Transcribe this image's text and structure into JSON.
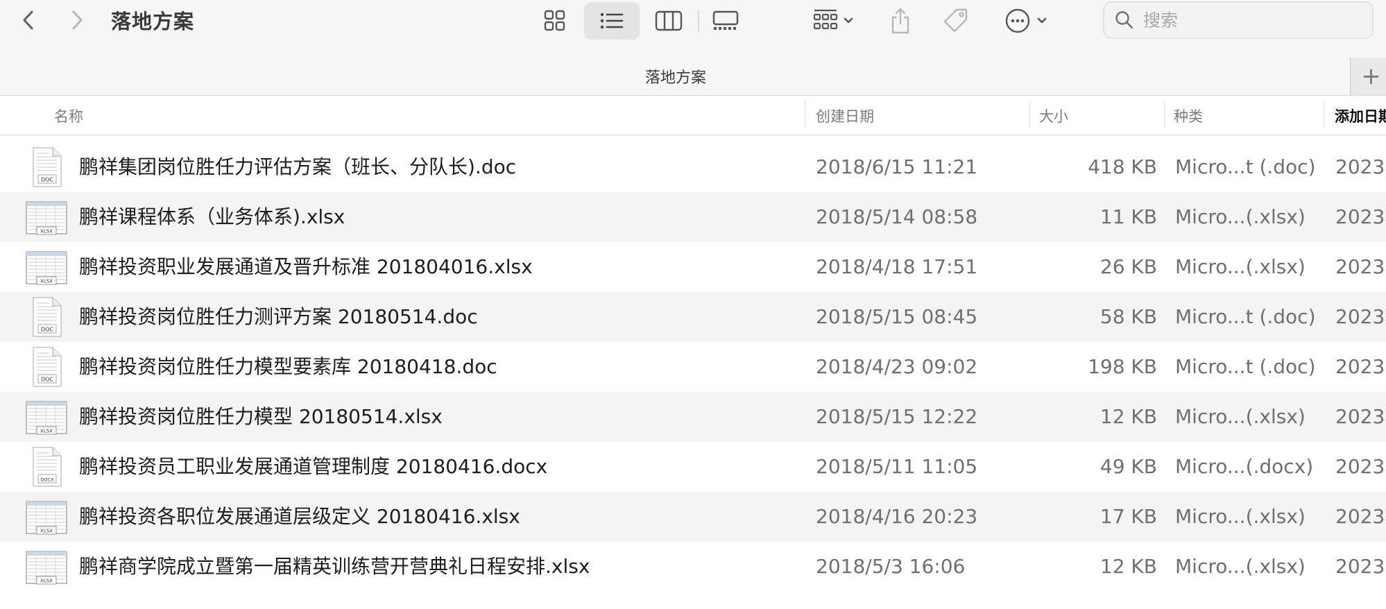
{
  "window": {
    "title": "落地方案",
    "tab_title": "落地方案",
    "tab_add": "+"
  },
  "toolbar": {
    "back_icon": "chevron-left-icon",
    "forward_icon": "chevron-right-icon",
    "view_modes": [
      "icon-view",
      "list-view",
      "column-view",
      "gallery-view"
    ],
    "active_view": "list-view",
    "group_icon": "group-by-icon",
    "share_icon": "share-icon",
    "tag_icon": "tag-icon",
    "more_icon": "ellipsis-circle-icon"
  },
  "search": {
    "placeholder": "搜索",
    "value": ""
  },
  "columns": {
    "name": "名称",
    "created": "创建日期",
    "size": "大小",
    "kind": "种类",
    "added": "添加日期"
  },
  "files": [
    {
      "name": "鹏祥集团岗位胜任力评估方案（班长、分队长).doc",
      "created": "2018/6/15 11:21",
      "size": "418 KB",
      "kind": "Micro...t (.doc)",
      "added": "2023",
      "type": "doc",
      "badge": "DOC"
    },
    {
      "name": "鹏祥课程体系（业务体系).xlsx",
      "created": "2018/5/14 08:58",
      "size": "11 KB",
      "kind": "Micro...(.xlsx)",
      "added": "2023",
      "type": "xlsx",
      "badge": "XLSX"
    },
    {
      "name": "鹏祥投资职业发展通道及晋升标准 201804016.xlsx",
      "created": "2018/4/18 17:51",
      "size": "26 KB",
      "kind": "Micro...(.xlsx)",
      "added": "2023",
      "type": "xlsx",
      "badge": "XLSX"
    },
    {
      "name": "鹏祥投资岗位胜任力测评方案 20180514.doc",
      "created": "2018/5/15 08:45",
      "size": "58 KB",
      "kind": "Micro...t (.doc)",
      "added": "2023",
      "type": "doc",
      "badge": "DOC"
    },
    {
      "name": "鹏祥投资岗位胜任力模型要素库 20180418.doc",
      "created": "2018/4/23 09:02",
      "size": "198 KB",
      "kind": "Micro...t (.doc)",
      "added": "2023",
      "type": "doc",
      "badge": "DOC"
    },
    {
      "name": "鹏祥投资岗位胜任力模型 20180514.xlsx",
      "created": "2018/5/15 12:22",
      "size": "12 KB",
      "kind": "Micro...(.xlsx)",
      "added": "2023",
      "type": "xlsx",
      "badge": "XLSX"
    },
    {
      "name": "鹏祥投资员工职业发展通道管理制度 20180416.docx",
      "created": "2018/5/11 11:05",
      "size": "49 KB",
      "kind": "Micro...(.docx)",
      "added": "2023",
      "type": "doc",
      "badge": "DOCX"
    },
    {
      "name": "鹏祥投资各职位发展通道层级定义 20180416.xlsx",
      "created": "2018/4/16 20:23",
      "size": "17 KB",
      "kind": "Micro...(.xlsx)",
      "added": "2023",
      "type": "xlsx",
      "badge": "XLSX"
    },
    {
      "name": "鹏祥商学院成立暨第一届精英训练营开营典礼日程安排.xlsx",
      "created": "2018/5/3 16:06",
      "size": "12 KB",
      "kind": "Micro...(.xlsx)",
      "added": "2023",
      "type": "xlsx",
      "badge": "XLSX"
    }
  ]
}
